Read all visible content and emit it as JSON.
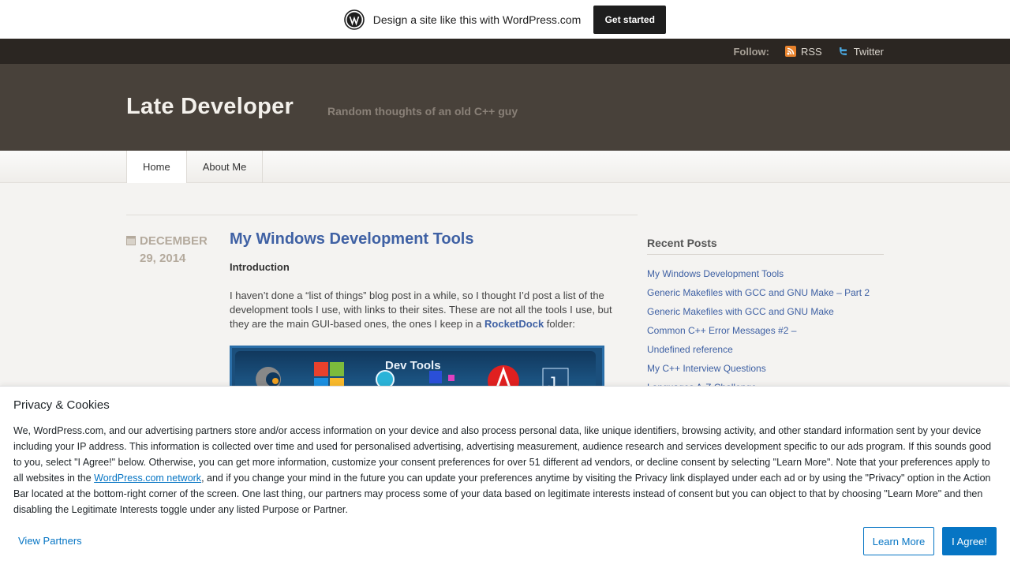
{
  "promo": {
    "text": "Design a site like this with WordPress.com",
    "button": "Get started",
    "icon": "wordpress-logo-icon"
  },
  "followbar": {
    "label": "Follow:",
    "links": [
      {
        "label": "RSS",
        "icon": "rss-icon"
      },
      {
        "label": "Twitter",
        "icon": "twitter-icon"
      }
    ]
  },
  "header": {
    "title": "Late Developer",
    "description": "Random thoughts of an old C++ guy"
  },
  "nav": {
    "items": [
      {
        "label": "Home",
        "active": true
      },
      {
        "label": "About Me",
        "active": false
      }
    ]
  },
  "post": {
    "date_line1": "December",
    "date_line2": "29, 2014",
    "title": "My Windows Development Tools",
    "intro": "Introduction",
    "para_before": "I haven’t done a “list of things” blog post in a while, so I thought I’d post a list of the development tools I use, with links to their sites. These are not all the tools I use, but they are the main GUI-based ones, the ones I keep in a ",
    "para_link": "RocketDock",
    "para_after": " folder:",
    "image_label": "Dev Tools"
  },
  "sidebar": {
    "title": "Recent Posts",
    "items": [
      "My Windows Development Tools",
      "Generic Makefiles with GCC and GNU Make – Part 2",
      "Generic Makefiles with GCC and GNU Make",
      "Common C++ Error Messages #2 – Undefined reference",
      "My C++ Interview Questions",
      "Languages A-Z Challenge"
    ]
  },
  "privacy": {
    "title": "Privacy & Cookies",
    "body_before": "We, WordPress.com, and our advertising partners store and/or access information on your device and also process personal data, like unique identifiers, browsing activity, and other standard information sent by your device including your IP address. This information is collected over time and used for personalised advertising, advertising measurement, audience research and services development specific to our ads program. If this sounds good to you, select \"I Agree!\" below. Otherwise, you can get more information, customize your consent preferences for over 51 different ad vendors, or decline consent by selecting \"Learn More\". Note that your preferences apply to all websites in the ",
    "body_link": "WordPress.com network",
    "body_after": ", and if you change your mind in the future you can update your preferences anytime by visiting the Privacy link displayed under each ad or by using the \"Privacy\" option in the Action Bar located at the bottom-right corner of the screen. One last thing, our partners may process some of your data based on legitimate interests instead of consent but you can object to that by choosing \"Learn More\" and then disabling the Legitimate Interests toggle under any listed Purpose or Partner.",
    "view_partners": "View Partners",
    "learn_more": "Learn More",
    "agree": "I Agree!"
  },
  "colors": {
    "link": "#3f61a4",
    "header_bg": "#48413a",
    "followbar_bg": "#2b2622",
    "privacy_accent": "#0675c4"
  }
}
